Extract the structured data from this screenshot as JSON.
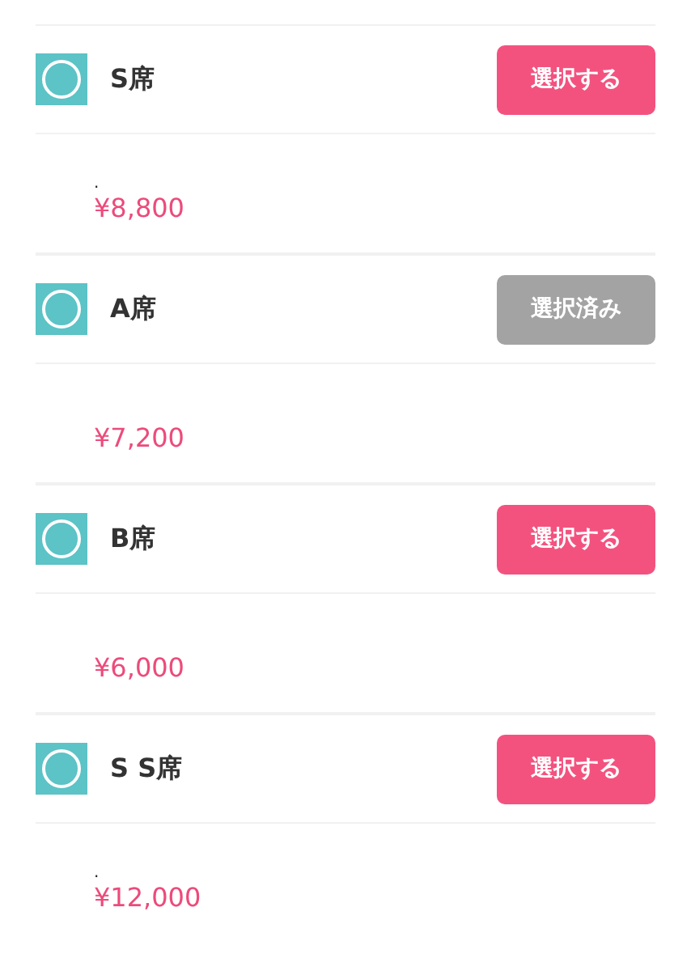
{
  "seats": [
    {
      "name": "S席",
      "button": {
        "label": "選択する",
        "disabled": false
      },
      "note": ".",
      "price": "¥8,800"
    },
    {
      "name": "A席",
      "button": {
        "label": "選択済み",
        "disabled": true
      },
      "price": "¥7,200"
    },
    {
      "name": "B席",
      "button": {
        "label": "選択する",
        "disabled": false
      },
      "price": "¥6,000"
    },
    {
      "name": "S S席",
      "button": {
        "label": "選択する",
        "disabled": false
      },
      "note": ".",
      "price": "¥12,000"
    }
  ]
}
